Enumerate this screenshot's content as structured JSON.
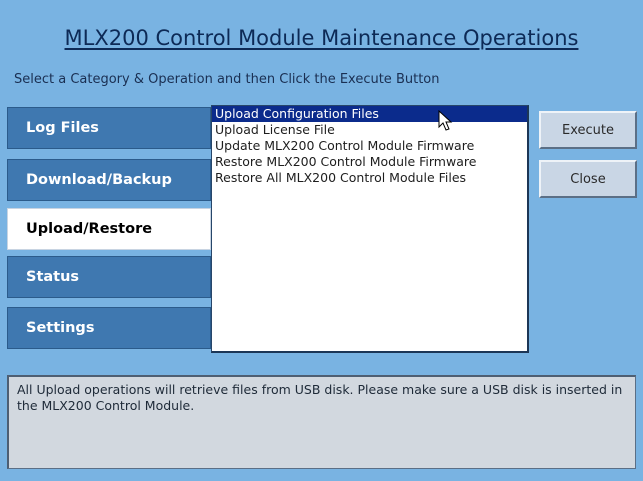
{
  "header": {
    "title": "MLX200 Control Module Maintenance Operations",
    "subtitle": "Select a Category & Operation and then Click the Execute Button"
  },
  "categories": [
    {
      "label": "Log Files",
      "selected": false
    },
    {
      "label": "Download/Backup",
      "selected": false
    },
    {
      "label": "Upload/Restore",
      "selected": true
    },
    {
      "label": "Status",
      "selected": false
    },
    {
      "label": "Settings",
      "selected": false
    }
  ],
  "operations": {
    "items": [
      "Upload Configuration Files",
      "Upload License File",
      "Update MLX200 Control Module Firmware",
      "Restore MLX200 Control Module Firmware",
      "Restore All MLX200 Control Module Files"
    ],
    "selected_index": 0
  },
  "buttons": {
    "execute_label": "Execute",
    "close_label": "Close"
  },
  "info": {
    "text": "All Upload operations will retrieve files from USB disk. Please make sure a USB disk is inserted in the MLX200 Control Module."
  },
  "colors": {
    "background": "#79b3e2",
    "category": "#3f78b0",
    "selection": "#0b2b8c"
  },
  "icons": {
    "pointer": "mouse-pointer-icon"
  }
}
